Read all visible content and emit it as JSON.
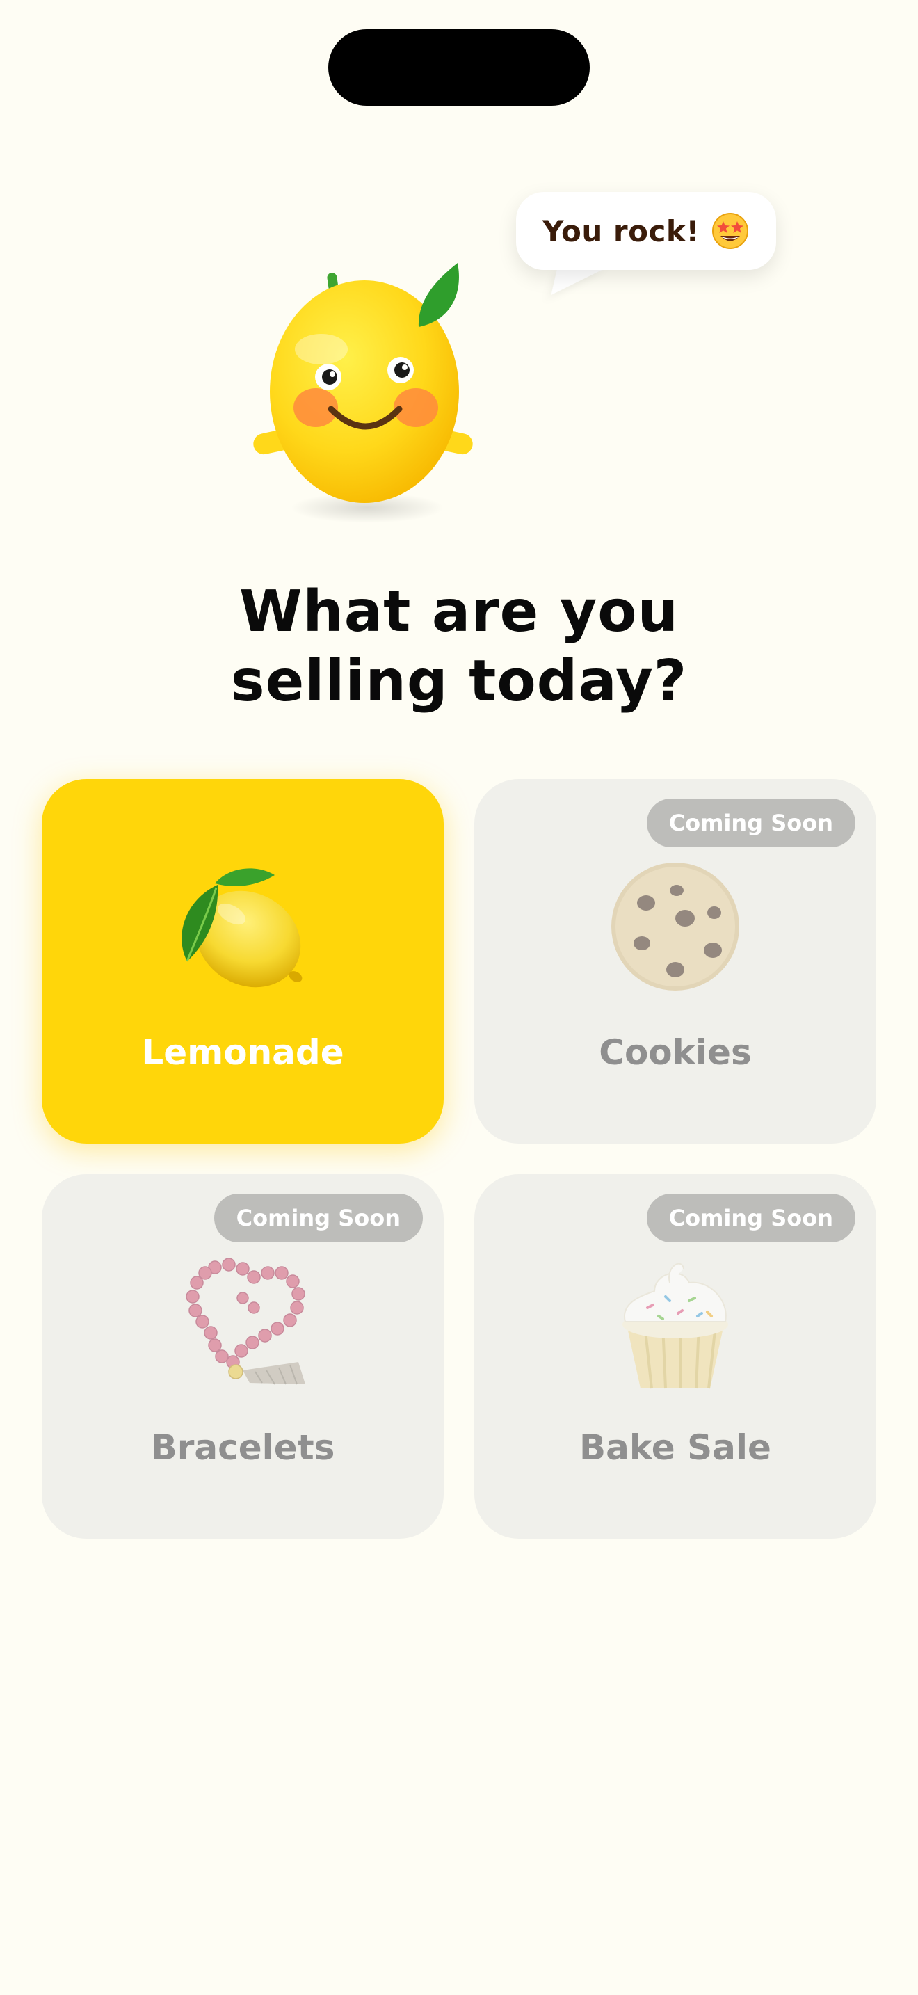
{
  "speech_bubble": {
    "text": "You rock!",
    "emoji_icon": "star-struck-face-icon"
  },
  "title": {
    "line1": "What are you",
    "line2": "selling today?"
  },
  "options": [
    {
      "label": "Lemonade",
      "icon": "lemon-icon",
      "selected": true,
      "badge": ""
    },
    {
      "label": "Cookies",
      "icon": "cookie-icon",
      "selected": false,
      "badge": "Coming Soon"
    },
    {
      "label": "Bracelets",
      "icon": "bead-bracelet-icon",
      "selected": false,
      "badge": "Coming Soon"
    },
    {
      "label": "Bake Sale",
      "icon": "cupcake-icon",
      "selected": false,
      "badge": "Coming Soon"
    }
  ],
  "colors": {
    "background": "#FEFDF4",
    "selected_card": "#FFD60A",
    "disabled_card": "#F0F0EB",
    "badge": "#BDBDBA"
  }
}
